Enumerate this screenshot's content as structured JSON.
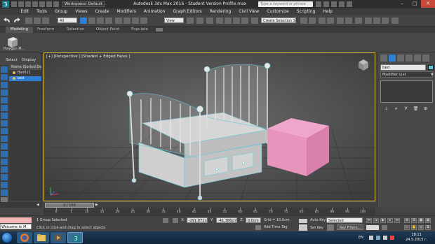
{
  "title_bar": {
    "workspace_label": "Workspace: Default",
    "app_title": "Autodesk 3ds Max 2016 - Student Version    Profile.max",
    "search_placeholder": "Type a keyword or phrase",
    "min_icon": "minimize-icon",
    "max_icon": "maximize-icon",
    "close_icon": "close-icon"
  },
  "menu": {
    "items": [
      "Edit",
      "Tools",
      "Group",
      "Views",
      "Create",
      "Modifiers",
      "Animation",
      "Graph Editors",
      "Rendering",
      "Civil View",
      "Customize",
      "Scripting",
      "Help"
    ]
  },
  "toolbar": {
    "undo_icon": "undo-icon",
    "redo_icon": "redo-icon",
    "filter_value": "All",
    "view_value": "View",
    "selection_set_placeholder": "Create Selection Se"
  },
  "ribbon": {
    "tabs": [
      "Modeling",
      "Freeform",
      "Selection",
      "Object Paint",
      "Populate"
    ],
    "polygon_label": "Polygon M..."
  },
  "scene_explorer": {
    "tab_select": "Select",
    "tab_display": "Display",
    "header": "Name (Sorted Desce",
    "rows": [
      "Box011",
      "bed"
    ]
  },
  "viewport": {
    "label": "[+] [Perspective ] [Shaded + Edged Faces ]"
  },
  "command_panel": {
    "object_name": "bed",
    "object_color": "#61c9dd",
    "modifier_list": "Modifier List"
  },
  "timeline": {
    "slider_text": "0 / 100",
    "ticks": [
      "0",
      "5",
      "10",
      "15",
      "20",
      "25",
      "30",
      "35",
      "40",
      "45",
      "50",
      "55",
      "60",
      "65",
      "70",
      "75",
      "80",
      "85",
      "90",
      "95",
      "100"
    ]
  },
  "status": {
    "maxscript_text": "Welcome to M",
    "selection_text": "1 Group Selected",
    "hint_text": "Click or click-and-drag to select objects",
    "x_label": "X:",
    "x_value": "-291,871cm",
    "y_label": "Y:",
    "y_value": "-41,386cm",
    "z_label": "Z:",
    "z_value": "0,0cm",
    "grid_text": "Grid = 10,0cm",
    "add_time_tag": "Add Time Tag",
    "auto_key": "Auto Key",
    "set_key": "Set Key",
    "selected_value": "Selected",
    "key_filters": "Key Filters..."
  },
  "taskbar": {
    "lang": "EN",
    "time": "18:11",
    "date": "24.5.2015 г."
  },
  "colors": {
    "accent_blue": "#2e7fd6",
    "viewport_border": "#e0c040",
    "pink_box": "#e994bd",
    "wire_cyan": "#61c9dd"
  }
}
